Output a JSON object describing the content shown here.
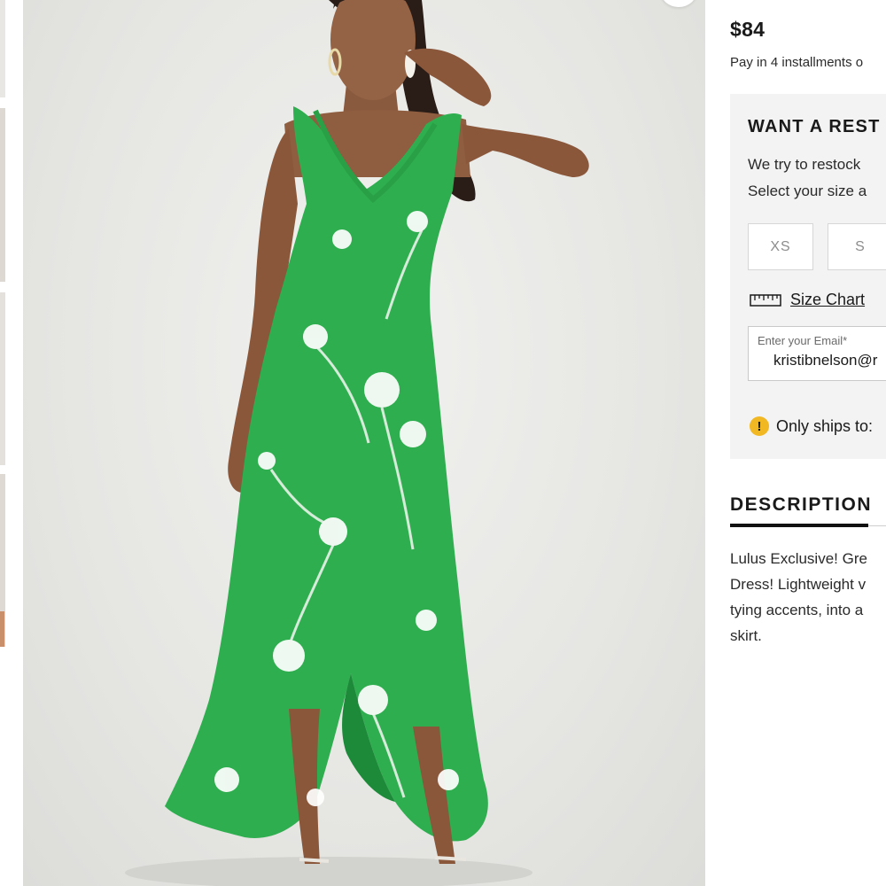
{
  "product": {
    "price": "$84",
    "installments": "Pay in 4 installments o"
  },
  "restock": {
    "title": "WANT A REST",
    "line1": "We try to restock",
    "line2": "Select your size a",
    "sizes": [
      "XS",
      "S"
    ]
  },
  "size_chart": {
    "label": "Size Chart",
    "icon": "ruler-icon"
  },
  "email": {
    "label": "Enter your Email*",
    "value": "kristibnelson@r"
  },
  "shipping": {
    "text": "Only ships to:",
    "icon": "warning-icon"
  },
  "description": {
    "title": "DESCRIPTION",
    "lines": [
      "Lulus Exclusive! Gre",
      "Dress! Lightweight v",
      "tying accents, into a",
      "skirt."
    ]
  },
  "colors": {
    "dress_green": "#2fae4f",
    "panel_gray": "#f3f3f3",
    "warning_yellow": "#f2b823"
  }
}
